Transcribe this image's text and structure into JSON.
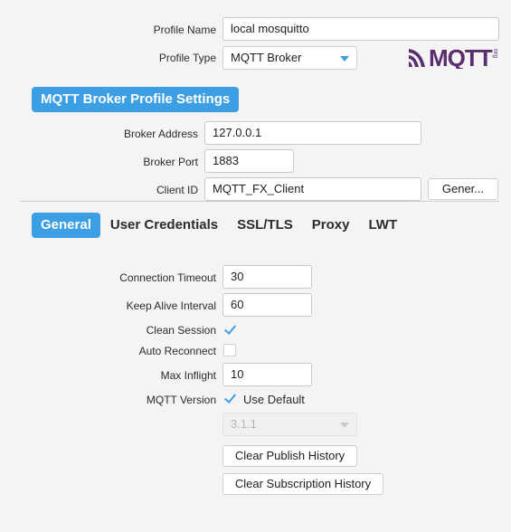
{
  "profile": {
    "name_label": "Profile Name",
    "name_value": "local mosquitto",
    "type_label": "Profile Type",
    "type_value": "MQTT Broker"
  },
  "logo": {
    "text": "MQTT",
    "sub": "org"
  },
  "section_title": "MQTT Broker Profile Settings",
  "broker": {
    "address_label": "Broker Address",
    "address_value": "127.0.0.1",
    "port_label": "Broker Port",
    "port_value": "1883",
    "client_id_label": "Client ID",
    "client_id_value": "MQTT_FX_Client",
    "generate_label": "Gener..."
  },
  "tabs": [
    {
      "label": "General",
      "active": true
    },
    {
      "label": "User Credentials",
      "active": false
    },
    {
      "label": "SSL/TLS",
      "active": false
    },
    {
      "label": "Proxy",
      "active": false
    },
    {
      "label": "LWT",
      "active": false
    }
  ],
  "general": {
    "connection_timeout_label": "Connection Timeout",
    "connection_timeout_value": "30",
    "keep_alive_label": "Keep Alive Interval",
    "keep_alive_value": "60",
    "clean_session_label": "Clean Session",
    "clean_session_checked": true,
    "auto_reconnect_label": "Auto Reconnect",
    "auto_reconnect_checked": false,
    "max_inflight_label": "Max Inflight",
    "max_inflight_value": "10",
    "mqtt_version_label": "MQTT Version",
    "use_default_label": "Use Default",
    "use_default_checked": true,
    "version_value": "3.1.1",
    "clear_publish_label": "Clear Publish History",
    "clear_subscription_label": "Clear Subscription History"
  },
  "colors": {
    "accent": "#3c9ee3",
    "logo": "#5a2d6e"
  }
}
